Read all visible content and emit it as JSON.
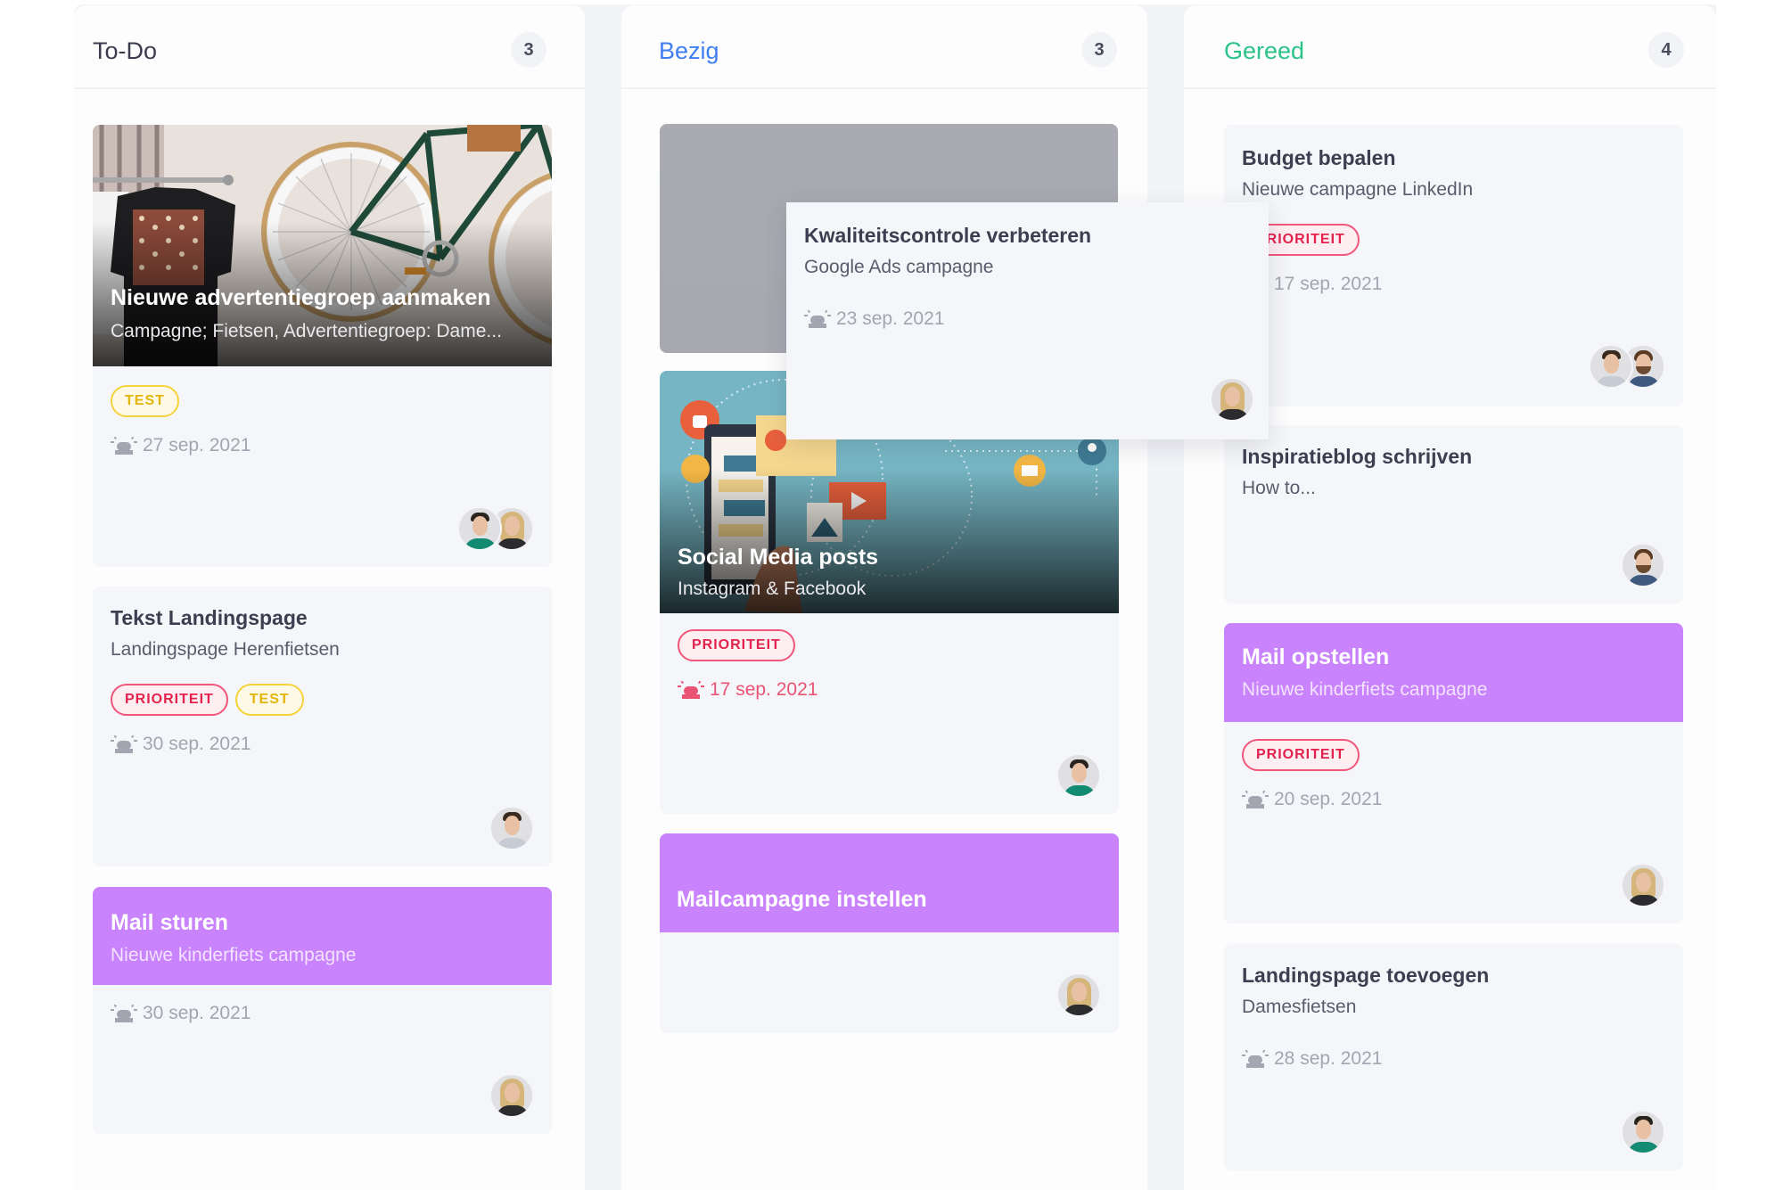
{
  "board": {
    "columns": [
      {
        "title": "To-Do",
        "count": "3",
        "title_color": "#3b3d4e",
        "cards": [
          {
            "title": "Nieuwe advertentiegroep aanmaken",
            "subtitle": "Campagne; Fietsen, Advertentiegroep: Dame...",
            "cover": "bicycle-shop-photo",
            "tags": [
              "TEST"
            ],
            "due": "27 sep. 2021",
            "assignees": [
              "man-green-shirt",
              "woman-blonde"
            ]
          },
          {
            "title": "Tekst Landingspage",
            "subtitle": "Landingspage Herenfietsen",
            "tags": [
              "PRIORITEIT",
              "TEST"
            ],
            "due": "30 sep. 2021",
            "assignees": [
              "man-light-shirt"
            ]
          },
          {
            "title": "Mail sturen",
            "subtitle": "Nieuwe kinderfiets campagne",
            "header_color": "#c883fd",
            "due": "30 sep. 2021",
            "assignees": [
              "woman-blonde"
            ]
          }
        ]
      },
      {
        "title": "Bezig",
        "count": "3",
        "title_color": "#3f7ef0",
        "cards": [
          {
            "title": "Kwaliteitscontrole verbeteren",
            "subtitle": "Google Ads campagne",
            "state": "dragging",
            "due": "23 sep. 2021",
            "assignees": [
              "woman-blonde"
            ]
          },
          {
            "title": "Social Media posts",
            "subtitle": "Instagram & Facebook",
            "cover": "social-media-illustration",
            "tags": [
              "PRIORITEIT"
            ],
            "due": "17 sep. 2021",
            "due_overdue": true,
            "assignees": [
              "man-green-shirt"
            ]
          },
          {
            "title": "Mailcampagne instellen",
            "header_color": "#c883fd",
            "assignees": [
              "woman-blonde"
            ]
          }
        ]
      },
      {
        "title": "Gereed",
        "count": "4",
        "title_color": "#2cc38a",
        "cards": [
          {
            "title": "Budget bepalen",
            "subtitle": "Nieuwe campagne LinkedIn",
            "tags": [
              "PRIORITEIT"
            ],
            "due": "17 sep. 2021",
            "assignees": [
              "man-light-shirt",
              "man-beard"
            ]
          },
          {
            "title": "Inspiratieblog schrijven",
            "subtitle": "How to...",
            "assignees": [
              "man-beard"
            ]
          },
          {
            "title": "Mail opstellen",
            "subtitle": "Nieuwe kinderfiets campagne",
            "header_color": "#c883fd",
            "tags": [
              "PRIORITEIT"
            ],
            "due": "20 sep. 2021",
            "assignees": [
              "woman-blonde"
            ]
          },
          {
            "title": "Landingspage toevoegen",
            "subtitle": "Damesfietsen",
            "due": "28 sep. 2021",
            "assignees": [
              "man-green-shirt"
            ]
          }
        ]
      }
    ]
  },
  "icons": {
    "due_date": "alarm-light-icon"
  },
  "colors": {
    "priority": "#e3224d",
    "test": "#e4b509",
    "purple_card": "#c883fd",
    "overdue": "#e95475"
  }
}
